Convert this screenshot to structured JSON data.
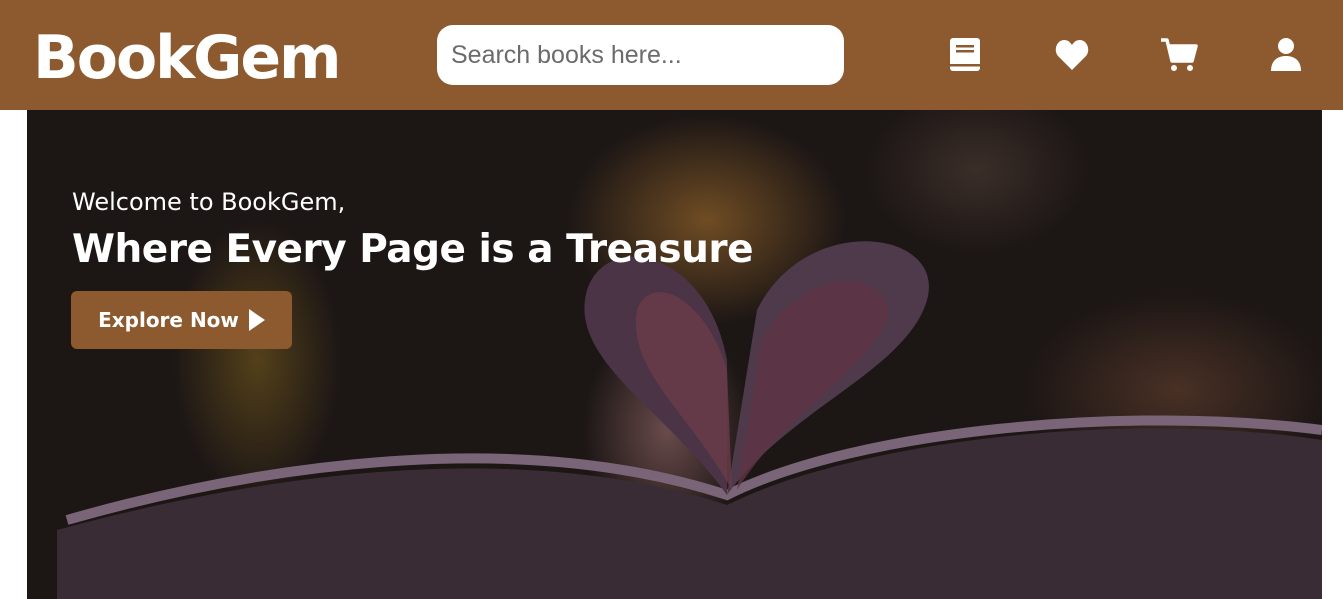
{
  "header": {
    "logo": "BookGem",
    "search": {
      "placeholder": "Search books here...",
      "value": ""
    },
    "icons": [
      "book-icon",
      "heart-icon",
      "cart-icon",
      "user-icon"
    ]
  },
  "hero": {
    "welcome": "Welcome to BookGem,",
    "tagline": "Where Every Page is a Treasure",
    "cta_label": "Explore Now"
  },
  "colors": {
    "brand": "#8c5a2e",
    "text": "#ffffff"
  }
}
